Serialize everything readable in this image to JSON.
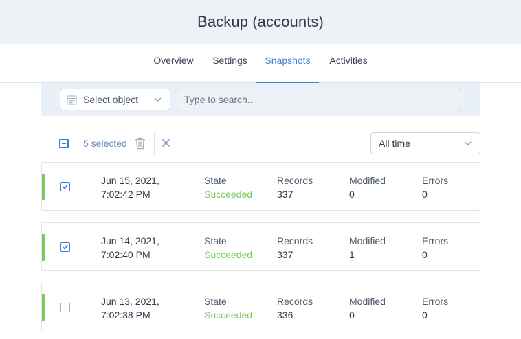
{
  "header": {
    "title": "Backup (accounts)"
  },
  "tabs": [
    {
      "label": "Overview"
    },
    {
      "label": "Settings"
    },
    {
      "label": "Snapshots"
    },
    {
      "label": "Activities"
    }
  ],
  "filters": {
    "select_object_label": "Select object",
    "search_placeholder": "Type to search...",
    "time_range": "All time"
  },
  "selection": {
    "count_label": "5 selected"
  },
  "columns": {
    "state": "State",
    "records": "Records",
    "modified": "Modified",
    "errors": "Errors"
  },
  "snapshots": [
    {
      "date": "Jun 15, 2021,",
      "time": "7:02:42 PM",
      "state": "Succeeded",
      "records": "337",
      "modified": "0",
      "errors": "0",
      "checked": true
    },
    {
      "date": "Jun 14, 2021,",
      "time": "7:02:40 PM",
      "state": "Succeeded",
      "records": "337",
      "modified": "1",
      "errors": "0",
      "checked": true
    },
    {
      "date": "Jun 13, 2021,",
      "time": "7:02:38 PM",
      "state": "Succeeded",
      "records": "336",
      "modified": "0",
      "errors": "0",
      "checked": false
    }
  ],
  "colors": {
    "accent": "#3d7fd9",
    "success": "#7cc95c"
  }
}
